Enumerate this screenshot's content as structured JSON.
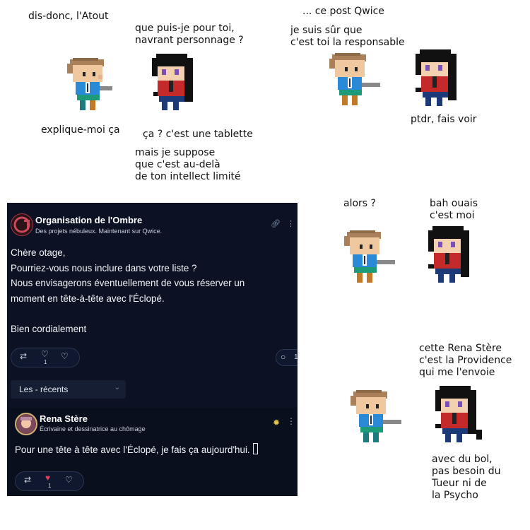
{
  "comic": {
    "panel1": {
      "boy_line1": "dis-donc, l'Atout",
      "girl_line1": [
        "que puis-je pour toi,",
        "navrant personnage ?"
      ],
      "boy_line2": "explique-moi ça",
      "girl_line2": "ça ? c'est une tablette",
      "girl_line3": [
        "mais je suppose",
        "que c'est au-delà",
        "de ton intellect limité"
      ]
    },
    "panel2": {
      "boy_line1": "... ce post Qwice",
      "boy_line2": [
        "je suis sûr que",
        "c'est toi la responsable"
      ],
      "girl_line1": "ptdr, fais voir"
    },
    "panel3": {
      "boy_line1": "alors ?",
      "girl_line1": [
        "bah ouais",
        "c'est moi"
      ]
    },
    "panel4": {
      "girl_line1": [
        "cette Rena Stère",
        "c'est la Providence",
        "qui me l'envoie"
      ],
      "girl_line2": [
        "avec du bol,",
        "pas besoin du",
        "Tueur ni de",
        "la Psycho"
      ]
    }
  },
  "post": {
    "org_avatar_text": "O",
    "org_name": "Organisation de l'Ombre",
    "org_subtitle": "Des projets nébuleux. Maintenant sur Qwice.",
    "body": [
      "Chère otage,",
      "Pourriez-vous nous inclure dans votre liste ?",
      "Nous envisagerons éventuellement de vous réserver un",
      "moment en tête-à-tête avec l'Éclopé.",
      "",
      "Bien cordialement"
    ],
    "like_count": "1",
    "comment_count": "1",
    "sort_label": "Les - récents"
  },
  "reply": {
    "author": "Rena Stère",
    "subtitle": "Écrivaine et dessinatrice au chômage",
    "text": "Pour une tête à tête avec l'Éclopé, je fais ça aujourd'hui.",
    "like_count": "1"
  },
  "icons": {
    "boost": "repost-icon",
    "like": "heart-icon",
    "heart_broken": "heart-crack-icon",
    "comment": "comment-icon",
    "more": "more-vertical-icon",
    "sun": "sun-icon",
    "link": "link-icon",
    "chevron": "chevron-down-icon"
  },
  "colors": {
    "panel_bg": "#0c1223",
    "like_active": "#e0405a",
    "sun": "#e2c24a"
  }
}
